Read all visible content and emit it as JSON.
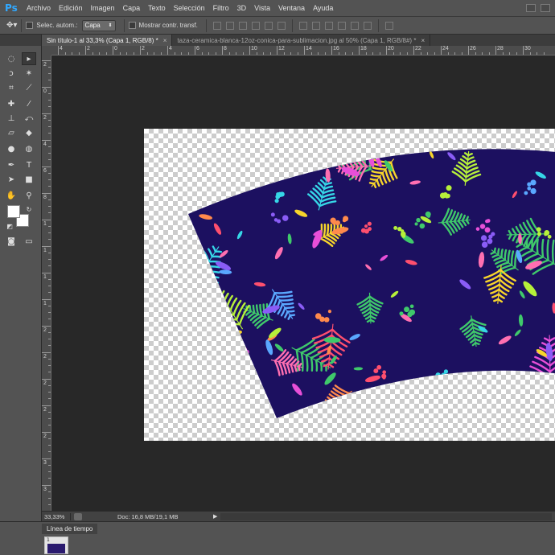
{
  "app": {
    "logo": "Ps"
  },
  "menu": [
    "Archivo",
    "Edición",
    "Imagen",
    "Capa",
    "Texto",
    "Selección",
    "Filtro",
    "3D",
    "Vista",
    "Ventana",
    "Ayuda"
  ],
  "options": {
    "auto_select_label": "Selec. autom.:",
    "auto_select_value": "Capa",
    "transform_label": "Mostrar contr. transf."
  },
  "tabs": [
    {
      "label": "Sin título-1 al 33,3% (Capa 1, RGB/8) *",
      "active": true
    },
    {
      "label": "taza-ceramica-blanca-12oz-conica-para-sublimacion.jpg al 50% (Capa 1, RGB/8#) *",
      "active": false
    }
  ],
  "ruler": {
    "h_numbers": [
      "4",
      "2",
      "0",
      "2",
      "4",
      "6",
      "8",
      "10",
      "12",
      "14",
      "16",
      "18",
      "20",
      "22",
      "24",
      "26",
      "28",
      "30"
    ],
    "v_numbers": [
      "2",
      "0",
      "2",
      "4",
      "6",
      "8",
      "1",
      "1",
      "1",
      "1",
      "2",
      "2",
      "2",
      "2",
      "2",
      "3",
      "3",
      "3"
    ]
  },
  "status": {
    "zoom": "33,33%",
    "doc": "Doc: 16,8 MB/19,1 MB",
    "arrow": "▶"
  },
  "timeline": {
    "tab_label": "Línea de tiempo",
    "frame_number": "1"
  },
  "icons": {
    "move": "move-icon",
    "marquee": "marquee-icon",
    "lasso": "lasso-icon",
    "wand": "magic-wand-icon",
    "crop": "crop-icon",
    "eyedropper": "eyedropper-icon",
    "heal": "healing-icon",
    "brush": "brush-icon",
    "stamp": "clone-stamp-icon",
    "history": "history-brush-icon",
    "eraser": "eraser-icon",
    "bucket": "paint-bucket-icon",
    "blur": "blur-icon",
    "dodge": "dodge-icon",
    "pen": "pen-icon",
    "type": "type-icon",
    "path": "path-selection-icon",
    "shape": "rectangle-shape-icon",
    "hand": "hand-icon",
    "zoom": "zoom-icon"
  },
  "colors": {
    "artwork_bg": "#1c1060",
    "foreground": "#ffffff",
    "background": "#ffffff"
  }
}
